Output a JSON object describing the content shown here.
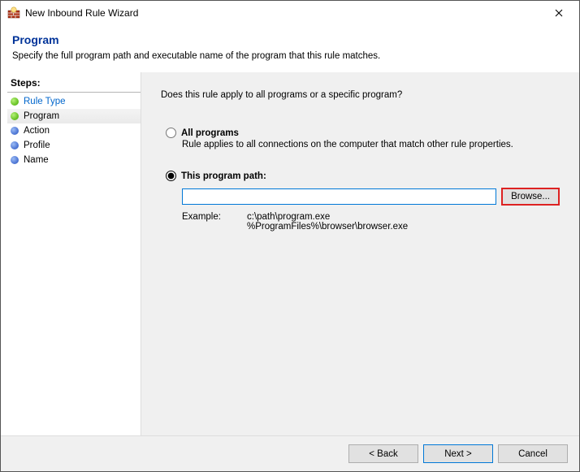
{
  "window": {
    "title": "New Inbound Rule Wizard"
  },
  "header": {
    "title": "Program",
    "subtitle": "Specify the full program path and executable name of the program that this rule matches."
  },
  "sidebar": {
    "label": "Steps:",
    "items": [
      {
        "label": "Rule Type",
        "state": "done"
      },
      {
        "label": "Program",
        "state": "current"
      },
      {
        "label": "Action",
        "state": "future"
      },
      {
        "label": "Profile",
        "state": "future"
      },
      {
        "label": "Name",
        "state": "future"
      }
    ]
  },
  "main": {
    "question": "Does this rule apply to all programs or a specific program?",
    "opt_all": {
      "label": "All programs",
      "desc": "Rule applies to all connections on the computer that match other rule properties."
    },
    "opt_path": {
      "label": "This program path:",
      "value": "",
      "browse": "Browse...",
      "example_label": "Example:",
      "example_values": "c:\\path\\program.exe\n%ProgramFiles%\\browser\\browser.exe"
    }
  },
  "buttons": {
    "back": "< Back",
    "next": "Next >",
    "cancel": "Cancel"
  }
}
